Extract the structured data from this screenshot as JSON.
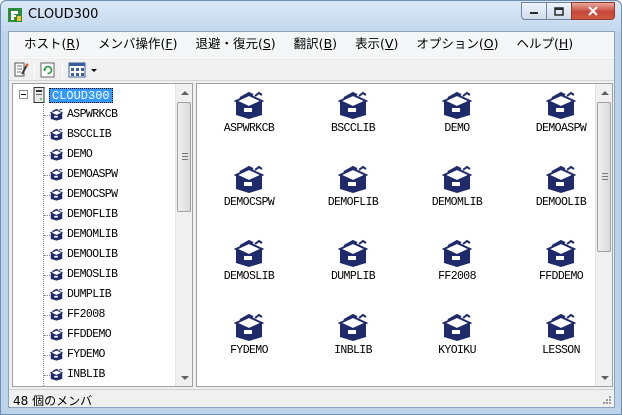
{
  "window": {
    "title": "CLOUD300",
    "colors": {
      "titlebar": "#c4d8ee",
      "selection": "#3399ff",
      "icon_navy": "#1f2a6b",
      "close_button": "#c7473a"
    }
  },
  "menubar": {
    "items": [
      {
        "label": "ホスト(",
        "accel": "R",
        "tail": ")"
      },
      {
        "label": "メンバ操作(",
        "accel": "F",
        "tail": ")"
      },
      {
        "label": "退避・復元(",
        "accel": "S",
        "tail": ")"
      },
      {
        "label": "翻訳(",
        "accel": "B",
        "tail": ")"
      },
      {
        "label": "表示(",
        "accel": "V",
        "tail": ")"
      },
      {
        "label": "オプション(",
        "accel": "O",
        "tail": ")"
      },
      {
        "label": "ヘルプ(",
        "accel": "H",
        "tail": ")"
      }
    ]
  },
  "toolbar": {
    "icons": [
      "properties-icon",
      "refresh-icon",
      "view-mode-icon"
    ]
  },
  "tree": {
    "root": "CLOUD300",
    "nodes": [
      "ASPWRKCB",
      "BSCCLIB",
      "DEMO",
      "DEMOASPW",
      "DEMOCSPW",
      "DEMOFLIB",
      "DEMOMLIB",
      "DEMOOLIB",
      "DEMOSLIB",
      "DUMPLIB",
      "FF2008",
      "FFDDEMO",
      "FYDEMO",
      "INBLIB"
    ]
  },
  "members": [
    "ASPWRKCB",
    "BSCCLIB",
    "DEMO",
    "DEMOASPW",
    "DEMOCSPW",
    "DEMOFLIB",
    "DEMOMLIB",
    "DEMOOLIB",
    "DEMOSLIB",
    "DUMPLIB",
    "FF2008",
    "FFDDEMO",
    "FYDEMO",
    "INBLIB",
    "KYOIKU",
    "LESSON"
  ],
  "status": {
    "text": "48 個のメンバ"
  }
}
